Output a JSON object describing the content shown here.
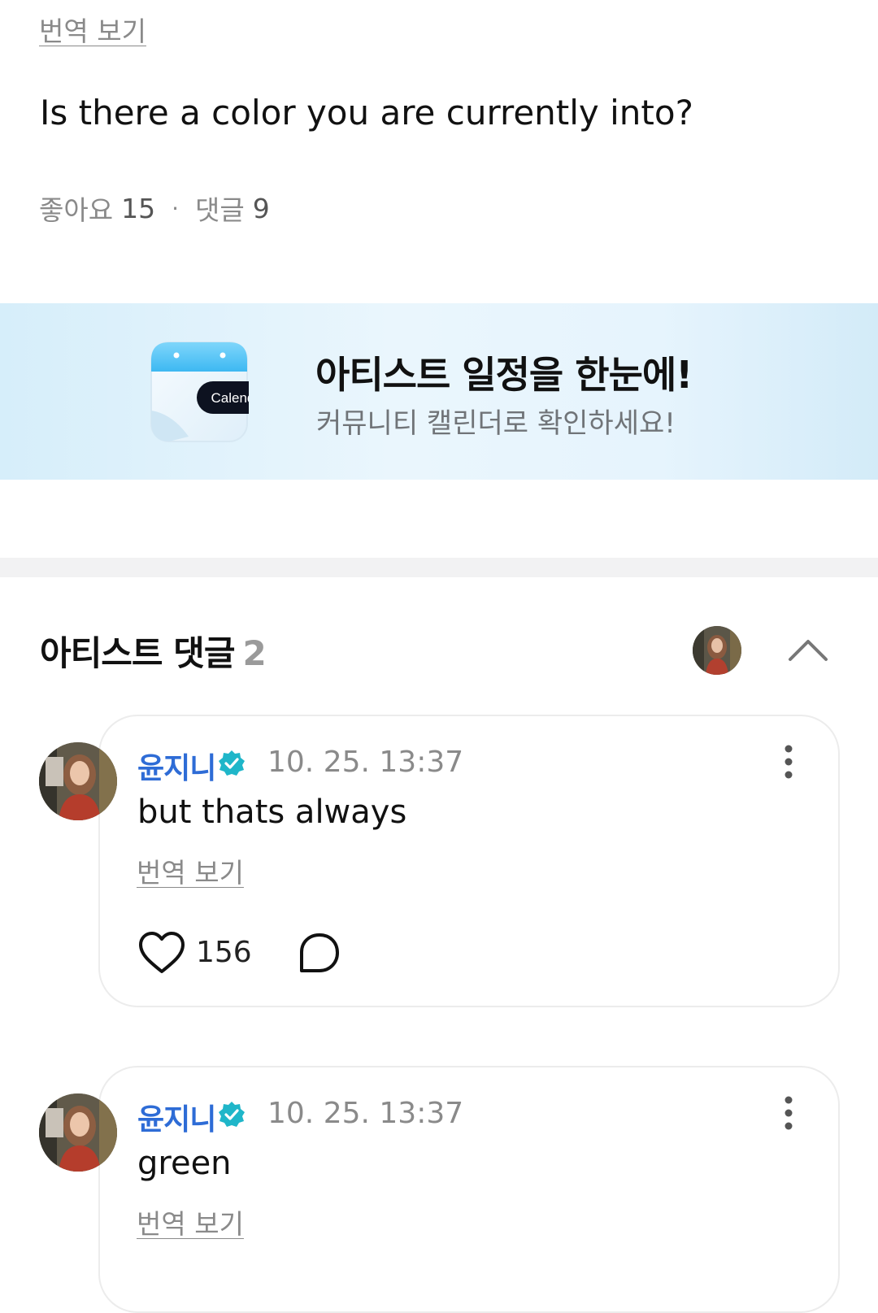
{
  "post": {
    "translate_label": "번역 보기",
    "text": "Is there a color you are currently into?",
    "likes_label": "좋아요",
    "likes_count": "15",
    "separator": "·",
    "comments_label": "댓글",
    "comments_count": "9"
  },
  "banner": {
    "calendar_label": "Calendar",
    "title": "아티스트 일정을 한눈에!",
    "subtitle": "커뮤니티 캘린더로 확인하세요!"
  },
  "artist_comments": {
    "title": "아티스트 댓글",
    "count": "2"
  },
  "comments": [
    {
      "author": "윤지니",
      "timestamp": "10. 25. 13:37",
      "text": "but thats always",
      "translate_label": "번역 보기",
      "likes": "156"
    },
    {
      "author": "윤지니",
      "timestamp": "10. 25. 13:37",
      "text": "green",
      "translate_label": "번역 보기"
    }
  ],
  "colors": {
    "accent_blue": "#2e6cd6",
    "verified_teal": "#1fb6c9",
    "muted_text": "#8a8a8a",
    "banner_bg": "#e6f4fd"
  },
  "icons": {
    "verified": "verified-badge-icon",
    "more": "more-vertical-icon",
    "like": "heart-icon",
    "reply": "comment-bubble-icon",
    "collapse": "chevron-up-icon",
    "calendar": "calendar-icon"
  }
}
